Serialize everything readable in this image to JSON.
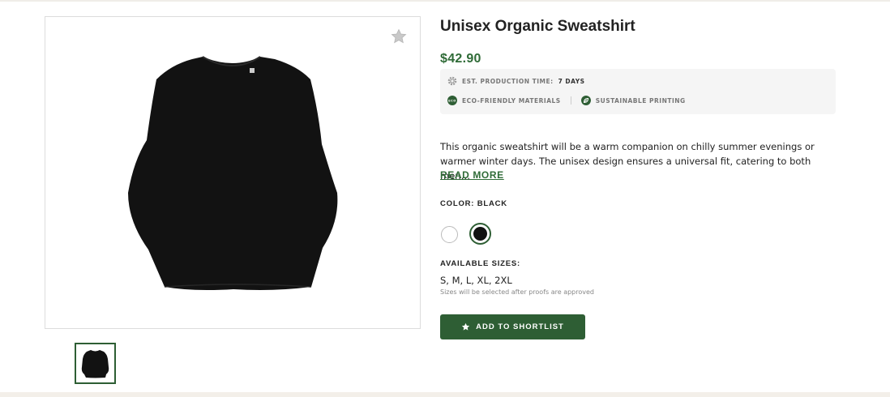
{
  "product": {
    "title": "Unisex Organic Sweatshirt",
    "price": "$42.90",
    "image_alt": "Black sweatshirt"
  },
  "features": {
    "production_label": "EST. PRODUCTION TIME:",
    "production_value": "7 DAYS",
    "eco_label": "ECO-FRIENDLY MATERIALS",
    "eco_badge": "ECO",
    "printing_label": "SUSTAINABLE PRINTING"
  },
  "description": {
    "text": "This organic sweatshirt will be a warm companion on chilly summer evenings or warmer winter days. The unisex design ensures a universal fit, catering to both men…",
    "read_more": "READ MORE"
  },
  "color": {
    "label": "COLOR: BLACK",
    "options": [
      "White",
      "Black"
    ],
    "selected": "Black"
  },
  "sizes": {
    "label": "AVAILABLE SIZES:",
    "value": "S, M, L, XL, 2XL",
    "note": "Sizes will be selected after proofs are approved"
  },
  "actions": {
    "shortlist_label": "ADD TO SHORTLIST"
  },
  "colors": {
    "accent": "#2e5e34",
    "price": "#2f6b37",
    "feature_bg": "#f5f5f5"
  },
  "icons": {
    "favorite": "star-icon",
    "production": "gear-icon",
    "eco": "eco-badge-icon",
    "printing": "leaf-icon",
    "shortlist": "star-icon"
  }
}
